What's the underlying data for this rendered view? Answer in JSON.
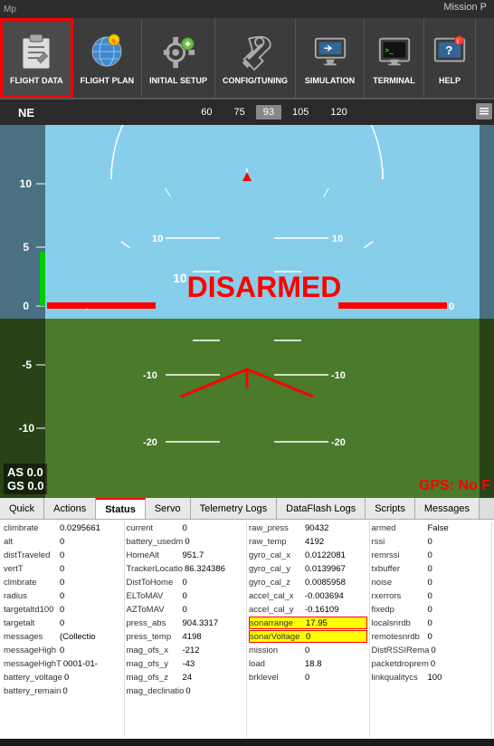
{
  "app": {
    "logo": "Mp",
    "title": "Mission P"
  },
  "navbar": {
    "items": [
      {
        "label": "FLIGHT DATA",
        "icon": "clipboard-icon",
        "active": true
      },
      {
        "label": "FLIGHT PLAN",
        "icon": "globe-icon",
        "active": false
      },
      {
        "label": "INITIAL SETUP",
        "icon": "gear-plus-icon",
        "active": false
      },
      {
        "label": "CONFIG/TUNING",
        "icon": "wrench-icon",
        "active": false
      },
      {
        "label": "SIMULATION",
        "icon": "monitor-icon",
        "active": false
      },
      {
        "label": "TERMINAL",
        "icon": "terminal-icon",
        "active": false
      },
      {
        "label": "HELP",
        "icon": "help-icon",
        "active": false
      }
    ]
  },
  "compass": {
    "direction": "NE",
    "marks": [
      "60",
      "75",
      "93",
      "105",
      "120"
    ],
    "active_mark": "93"
  },
  "hud": {
    "status": "DISARMED",
    "status_prefix": "10",
    "speed_label_as": "AS 0.0",
    "speed_label_gs": "GS 0.0",
    "gps_status": "GPS: No F",
    "pitch_marks": [
      "-20",
      "-10",
      "0",
      "10"
    ],
    "zero_label": "0"
  },
  "tabs": [
    {
      "label": "Quick",
      "active": false
    },
    {
      "label": "Actions",
      "active": false
    },
    {
      "label": "Status",
      "active": true
    },
    {
      "label": "Servo",
      "active": false
    },
    {
      "label": "Telemetry Logs",
      "active": false
    },
    {
      "label": "DataFlash Logs",
      "active": false
    },
    {
      "label": "Scripts",
      "active": false
    },
    {
      "label": "Messages",
      "active": false
    }
  ],
  "status_data": {
    "col1": [
      {
        "key": "climbrate",
        "val": "0.0295661"
      },
      {
        "key": "alt",
        "val": "0"
      },
      {
        "key": "distTraveled",
        "val": "0"
      },
      {
        "key": "vertT",
        "val": "0"
      },
      {
        "key": "clmbrate",
        "val": "0"
      },
      {
        "key": "radius",
        "val": "0"
      },
      {
        "key": "targetaltd100",
        "val": "0"
      },
      {
        "key": "targetalt",
        "val": "0"
      },
      {
        "key": "messages",
        "val": "(Collectio"
      },
      {
        "key": "messageHigh",
        "val": "0"
      },
      {
        "key": "messageHighT",
        "val": "0001-01-"
      },
      {
        "key": "battery_voltage",
        "val": "0"
      },
      {
        "key": "battery_remain",
        "val": "0"
      }
    ],
    "col2": [
      {
        "key": "current",
        "val": "0"
      },
      {
        "key": "battery_usedm",
        "val": "0"
      },
      {
        "key": "HomeAlt",
        "val": "951.7"
      },
      {
        "key": "TrackerLocatio",
        "val": "86.324386"
      },
      {
        "key": "DistToHome",
        "val": "0"
      },
      {
        "key": "ELToMAV",
        "val": "0"
      },
      {
        "key": "AZToMAV",
        "val": "0"
      },
      {
        "key": "press_abs",
        "val": "904.3317"
      },
      {
        "key": "press_temp",
        "val": "4198"
      },
      {
        "key": "mag_ofs_x",
        "val": "-212"
      },
      {
        "key": "mag_ofs_y",
        "val": "-43"
      },
      {
        "key": "mag_ofs_z",
        "val": "24"
      },
      {
        "key": "mag_declinatio",
        "val": "0"
      }
    ],
    "col3": [
      {
        "key": "raw_press",
        "val": "90432"
      },
      {
        "key": "raw_temp",
        "val": "4192"
      },
      {
        "key": "gyro_cal_x",
        "val": "0.0122081"
      },
      {
        "key": "gyro_cal_y",
        "val": "0.0139967"
      },
      {
        "key": "gyro_cal_z",
        "val": "0.0085958"
      },
      {
        "key": "accel_cal_x",
        "val": "-0.003694"
      },
      {
        "key": "accel_cal_y",
        "val": "-0.16109"
      },
      {
        "key": "sonarrange",
        "val": "17.95",
        "highlight": true
      },
      {
        "key": "sonarVoltage",
        "val": "0",
        "highlight": true
      },
      {
        "key": "mission",
        "val": "0"
      },
      {
        "key": "load",
        "val": "18.8"
      },
      {
        "key": "brklevel",
        "val": "0"
      }
    ],
    "col4": [
      {
        "key": "armed",
        "val": "False"
      },
      {
        "key": "rssi",
        "val": "0"
      },
      {
        "key": "remrssi",
        "val": "0"
      },
      {
        "key": "txbuffer",
        "val": "0"
      },
      {
        "key": "noise",
        "val": "0"
      },
      {
        "key": "rxerrors",
        "val": "0"
      },
      {
        "key": "fixedp",
        "val": "0"
      },
      {
        "key": "localsnrdb",
        "val": "0"
      },
      {
        "key": "remotesnrdb",
        "val": "0"
      },
      {
        "key": "DistRSSIRema",
        "val": "0"
      },
      {
        "key": "packetdroprem",
        "val": "0"
      },
      {
        "key": "linkqualitycs",
        "val": "100"
      }
    ]
  }
}
